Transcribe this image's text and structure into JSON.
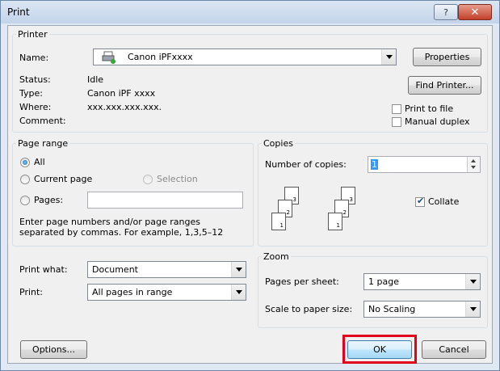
{
  "window": {
    "title": "Print",
    "help_icon": "?",
    "close_icon": "✕"
  },
  "printer": {
    "group_label": "Printer",
    "name_label": "Name:",
    "name_value": "Canon iPFxxxx",
    "status_label": "Status:",
    "status_value": "Idle",
    "type_label": "Type:",
    "type_value": "Canon iPF xxxx",
    "where_label": "Where:",
    "where_value": "xxx.xxx.xxx.xxx.",
    "comment_label": "Comment:",
    "properties_button": "Properties",
    "find_printer_button": "Find Printer...",
    "print_to_file_label": "Print to file",
    "print_to_file_checked": false,
    "manual_duplex_label": "Manual duplex",
    "manual_duplex_checked": false
  },
  "page_range": {
    "group_label": "Page range",
    "all_label": "All",
    "current_page_label": "Current page",
    "selection_label": "Selection",
    "pages_label": "Pages:",
    "pages_value": "",
    "selected": "All",
    "hint_line1": "Enter page numbers and/or page ranges",
    "hint_line2": "separated by commas.  For example, 1,3,5–12"
  },
  "copies": {
    "group_label": "Copies",
    "number_label": "Number of copies:",
    "number_value": "1",
    "collate_label": "Collate",
    "collate_checked": true,
    "page_numbers": [
      "1",
      "2",
      "3"
    ]
  },
  "print_what": {
    "label": "Print what:",
    "value": "Document"
  },
  "print": {
    "label": "Print:",
    "value": "All pages in range"
  },
  "zoom": {
    "group_label": "Zoom",
    "pages_per_sheet_label": "Pages per sheet:",
    "pages_per_sheet_value": "1 page",
    "scale_label": "Scale to paper size:",
    "scale_value": "No Scaling"
  },
  "footer": {
    "options_button": "Options...",
    "ok_button": "OK",
    "cancel_button": "Cancel"
  },
  "colors": {
    "highlight": "#e3001b",
    "accent": "#1b62a8"
  }
}
